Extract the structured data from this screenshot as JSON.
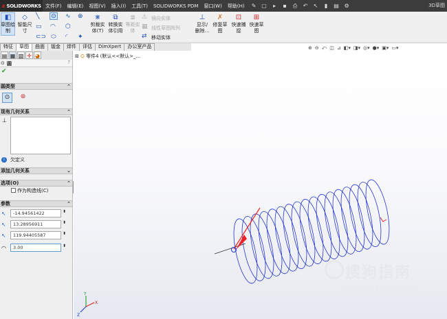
{
  "app": {
    "logo_text": "SOLIDWORKS",
    "title": "3D草图"
  },
  "menu": {
    "items": [
      "文件(F)",
      "编辑(E)",
      "视图(V)",
      "插入(I)",
      "工具(T)",
      "SOLIDWORKS PDM",
      "窗口(W)",
      "帮助(H)"
    ]
  },
  "commands": {
    "sketch_drawing": "草图绘\n制",
    "smart_dim": "智能尺\n寸",
    "trim_entities": "剪裁实\n体(T)",
    "convert_entities": "转换实\n体引用",
    "offset_entities": "等距实\n体",
    "mirror_entities": "镜向实体",
    "linear_pattern": "线性草图阵列",
    "move_entities": "移动实体",
    "show_delete": "显示/\n删除...",
    "repair_sketch": "修复草\n图",
    "quick_snap": "快速捕\n捉",
    "rapid_sketch": "快速草\n图"
  },
  "tabs": [
    "特征",
    "草图",
    "曲面",
    "钣金",
    "焊件",
    "评估",
    "DimXpert",
    "办公室产品"
  ],
  "active_tab": "草图",
  "panel": {
    "title": "圆",
    "type_section": "圆类型",
    "relations_section": "现有几何关系",
    "underdefined": "欠定义",
    "add_relations_section": "添加几何关系",
    "options_section": "选项(O)",
    "construction_checkbox": "作为构造线(C)",
    "params_section": "参数",
    "param_x": "-14.94561422",
    "param_y": "13.28956911",
    "param_z": "119.94405587",
    "param_radius": "3.00"
  },
  "tree": {
    "part_name": "零件4 (默认<<默认>_..."
  },
  "watermark": {
    "title": "搜狗指南",
    "url": "zhinan.sogou.com"
  },
  "colors": {
    "helix": "#2233cc",
    "menubar_bg": "#3c3c3c",
    "axis_x": "#cc1111",
    "axis_y": "#119911",
    "axis_z": "#1133cc",
    "arrow": "#ee2222"
  }
}
